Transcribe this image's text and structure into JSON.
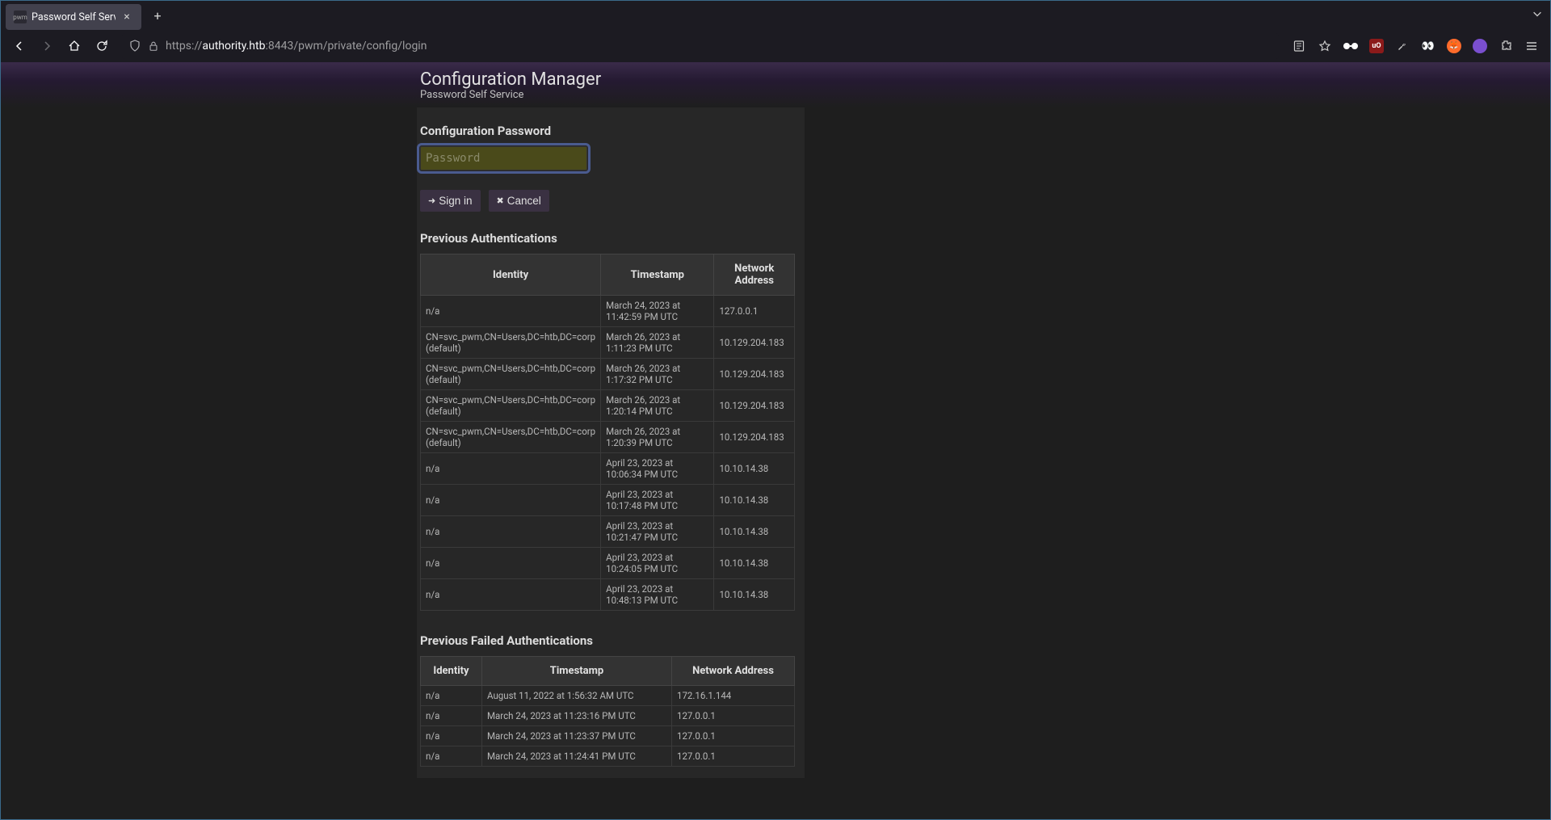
{
  "browser": {
    "tab_title": "Password Self Service",
    "url_scheme": "https://",
    "url_domain": "authority.htb",
    "url_path": ":8443/pwm/private/config/login"
  },
  "header": {
    "title": "Configuration Manager",
    "subtitle": "Password Self Service"
  },
  "form": {
    "heading": "Configuration Password",
    "placeholder": "Password",
    "signin_label": "Sign in",
    "cancel_label": "Cancel"
  },
  "auth_section": {
    "heading": "Previous Authentications",
    "columns": {
      "c0": "Identity",
      "c1": "Timestamp",
      "c2": "Network Address"
    },
    "rows": [
      {
        "identity": "n/a",
        "timestamp": "March 24, 2023 at 11:42:59 PM UTC",
        "address": "127.0.0.1"
      },
      {
        "identity": "CN=svc_pwm,CN=Users,DC=htb,DC=corp (default)",
        "timestamp": "March 26, 2023 at 1:11:23 PM UTC",
        "address": "10.129.204.183"
      },
      {
        "identity": "CN=svc_pwm,CN=Users,DC=htb,DC=corp (default)",
        "timestamp": "March 26, 2023 at 1:17:32 PM UTC",
        "address": "10.129.204.183"
      },
      {
        "identity": "CN=svc_pwm,CN=Users,DC=htb,DC=corp (default)",
        "timestamp": "March 26, 2023 at 1:20:14 PM UTC",
        "address": "10.129.204.183"
      },
      {
        "identity": "CN=svc_pwm,CN=Users,DC=htb,DC=corp (default)",
        "timestamp": "March 26, 2023 at 1:20:39 PM UTC",
        "address": "10.129.204.183"
      },
      {
        "identity": "n/a",
        "timestamp": "April 23, 2023 at 10:06:34 PM UTC",
        "address": "10.10.14.38"
      },
      {
        "identity": "n/a",
        "timestamp": "April 23, 2023 at 10:17:48 PM UTC",
        "address": "10.10.14.38"
      },
      {
        "identity": "n/a",
        "timestamp": "April 23, 2023 at 10:21:47 PM UTC",
        "address": "10.10.14.38"
      },
      {
        "identity": "n/a",
        "timestamp": "April 23, 2023 at 10:24:05 PM UTC",
        "address": "10.10.14.38"
      },
      {
        "identity": "n/a",
        "timestamp": "April 23, 2023 at 10:48:13 PM UTC",
        "address": "10.10.14.38"
      }
    ]
  },
  "failed_section": {
    "heading": "Previous Failed Authentications",
    "columns": {
      "c0": "Identity",
      "c1": "Timestamp",
      "c2": "Network Address"
    },
    "rows": [
      {
        "identity": "n/a",
        "timestamp": "August 11, 2022 at 1:56:32 AM UTC",
        "address": "172.16.1.144"
      },
      {
        "identity": "n/a",
        "timestamp": "March 24, 2023 at 11:23:16 PM UTC",
        "address": "127.0.0.1"
      },
      {
        "identity": "n/a",
        "timestamp": "March 24, 2023 at 11:23:37 PM UTC",
        "address": "127.0.0.1"
      },
      {
        "identity": "n/a",
        "timestamp": "March 24, 2023 at 11:24:41 PM UTC",
        "address": "127.0.0.1"
      }
    ]
  }
}
